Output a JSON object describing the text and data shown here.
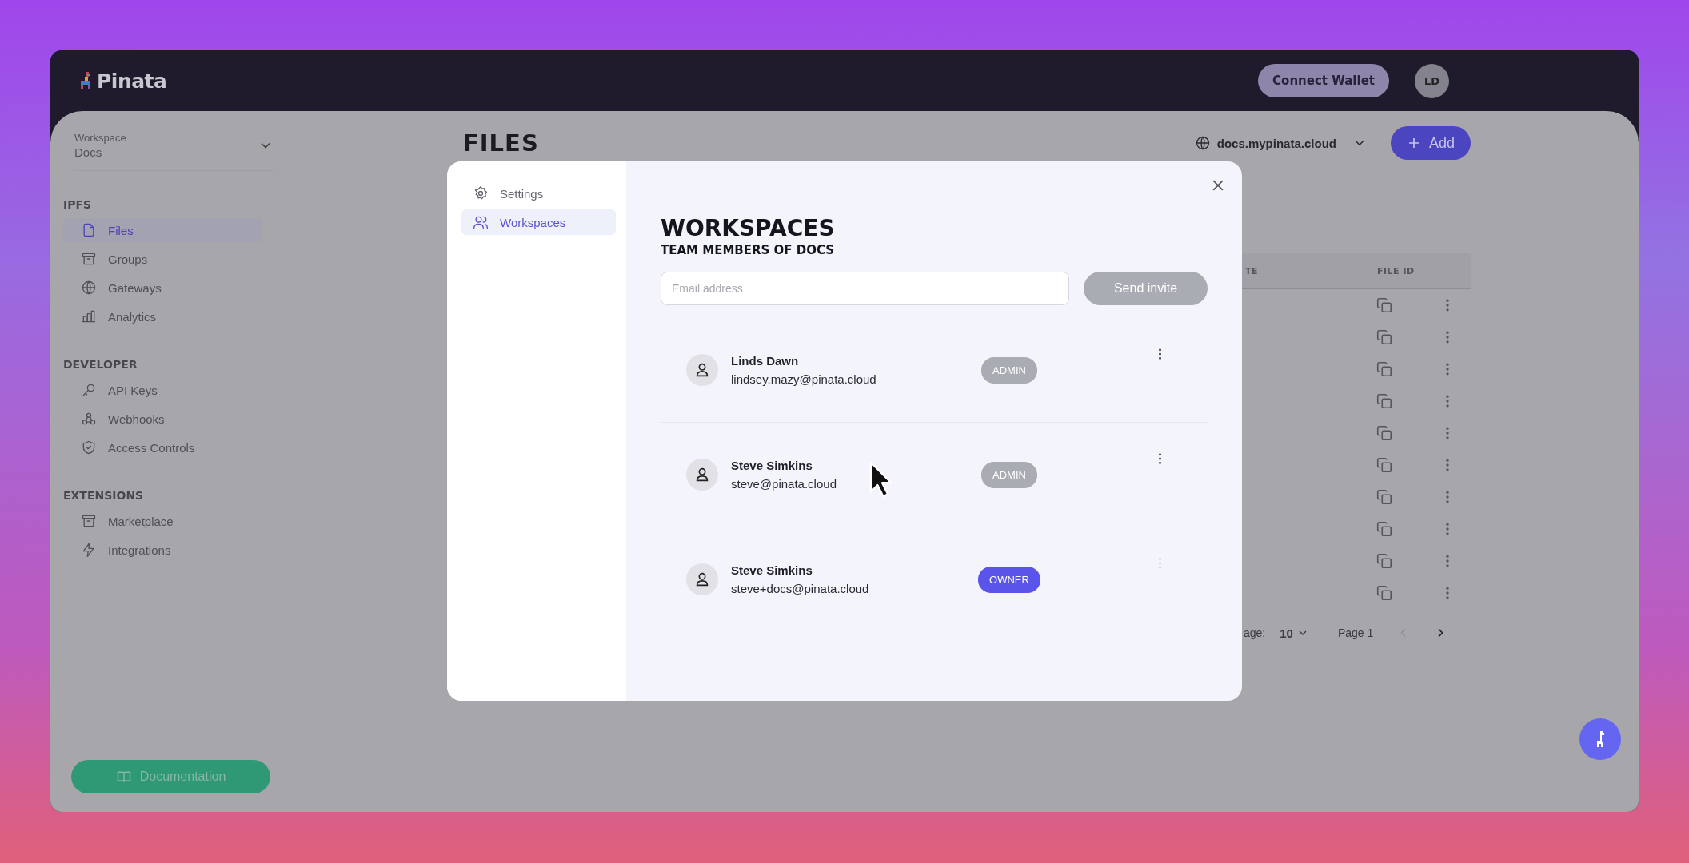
{
  "header": {
    "logo": "Pinata",
    "connect_wallet": "Connect Wallet",
    "avatar": "LD"
  },
  "sidebar": {
    "workspace_label": "Workspace",
    "workspace": "Docs",
    "sections": [
      {
        "title": "IPFS",
        "items": [
          {
            "label": "Files",
            "kind": "file",
            "selected": true
          },
          {
            "label": "Groups",
            "kind": "archive",
            "selected": false
          },
          {
            "label": "Gateways",
            "kind": "globe",
            "selected": false
          },
          {
            "label": "Analytics",
            "kind": "chart",
            "selected": false
          }
        ]
      },
      {
        "title": "DEVELOPER",
        "items": [
          {
            "label": "API Keys",
            "kind": "key",
            "selected": false
          },
          {
            "label": "Webhooks",
            "kind": "webhook",
            "selected": false
          },
          {
            "label": "Access Controls",
            "kind": "shield",
            "selected": false
          }
        ]
      },
      {
        "title": "EXTENSIONS",
        "items": [
          {
            "label": "Marketplace",
            "kind": "archive",
            "selected": false
          },
          {
            "label": "Integrations",
            "kind": "bolt",
            "selected": false
          }
        ]
      }
    ],
    "documentation": "Documentation"
  },
  "page": {
    "title": "FILES",
    "gateway": "docs.mypinata.cloud",
    "add_button": "Add",
    "table": {
      "columns": [
        "TE",
        "FILE ID"
      ]
    },
    "pagination": {
      "rows_per_page_label": "age:",
      "rows_per_page": "10",
      "page": "Page 1",
      "prev_disabled": true,
      "next_disabled": false
    }
  },
  "modal": {
    "nav": [
      {
        "label": "Settings",
        "kind": "gear",
        "selected": false
      },
      {
        "label": "Workspaces",
        "kind": "users",
        "selected": true
      }
    ],
    "title": "WORKSPACES",
    "subtitle": "TEAM MEMBERS OF DOCS",
    "email": {
      "placeholder": "Email address"
    },
    "send_button": {
      "label": "Send invite",
      "disabled": true
    },
    "members": [
      {
        "name": "Linds Dawn",
        "email": "lindsey.mazy@pinata.cloud",
        "role": "ADMIN",
        "kind": "admin",
        "menu_disabled": false
      },
      {
        "name": "Steve Simkins",
        "email": "steve@pinata.cloud",
        "role": "ADMIN",
        "kind": "admin",
        "menu_disabled": false
      },
      {
        "name": "Steve Simkins",
        "email": "steve+docs@pinata.cloud",
        "role": "OWNER",
        "kind": "owner",
        "menu_disabled": true
      }
    ]
  }
}
